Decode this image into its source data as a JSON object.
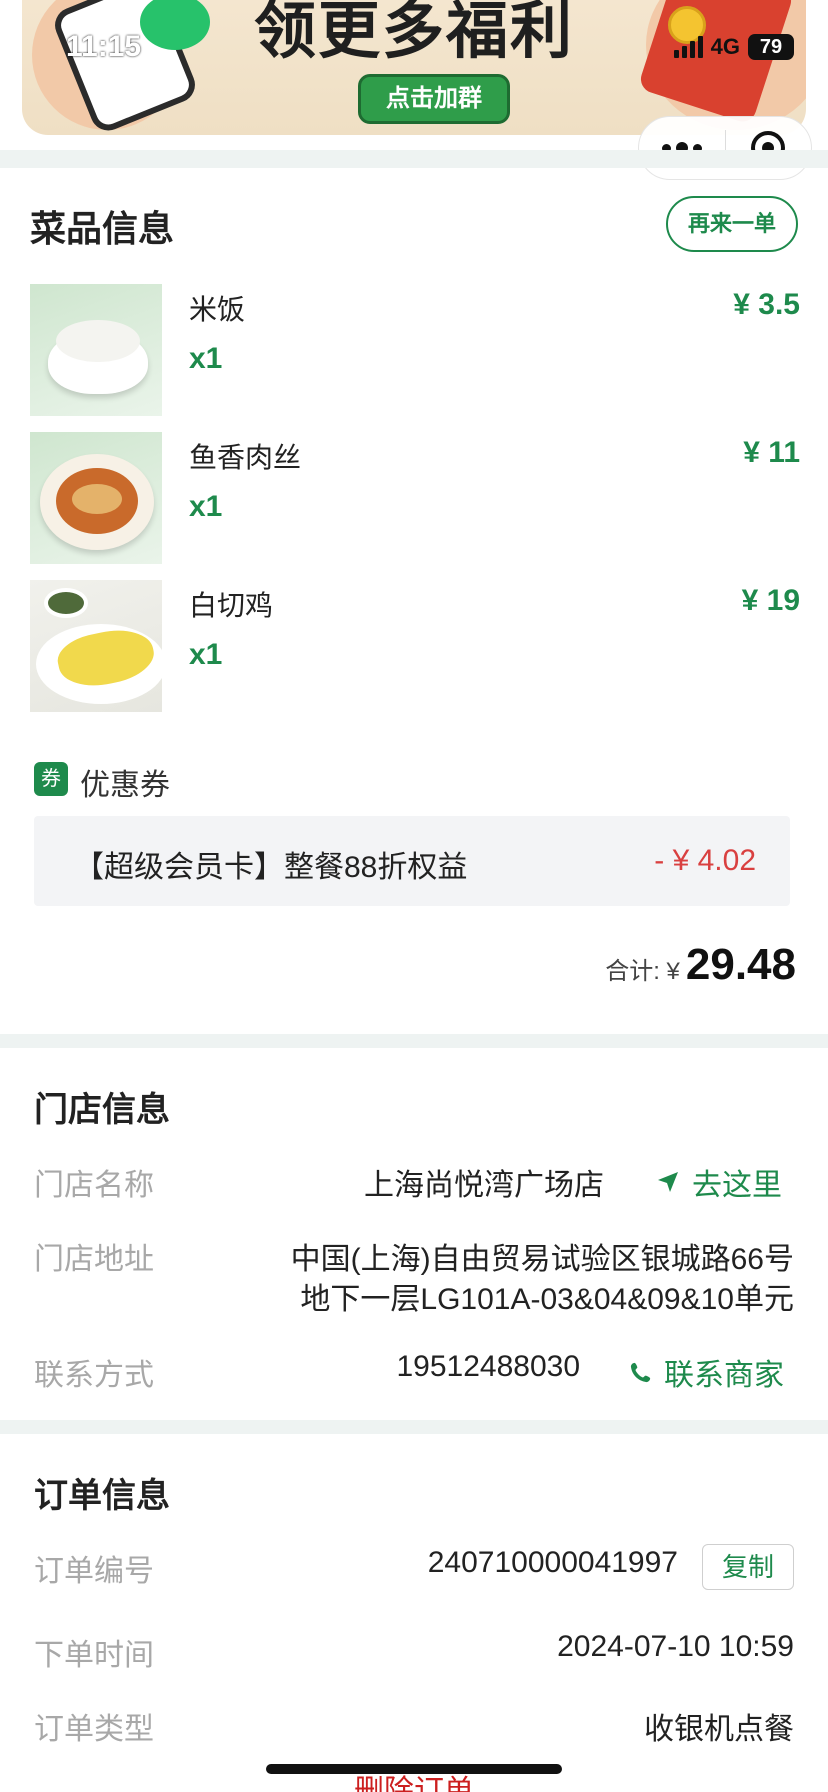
{
  "status_bar": {
    "time": "11:15",
    "network": "4G",
    "battery": "79"
  },
  "banner": {
    "headline": "领更多福利",
    "cta": "点击加群"
  },
  "dishes_section": {
    "title": "菜品信息",
    "reorder": "再来一单",
    "items": [
      {
        "name": "米饭",
        "qty": "x1",
        "price": "¥ 3.5"
      },
      {
        "name": "鱼香肉丝",
        "qty": "x1",
        "price": "¥ 11"
      },
      {
        "name": "白切鸡",
        "qty": "x1",
        "price": "¥ 19"
      }
    ],
    "coupon_tag": "券",
    "coupon_label": "优惠券",
    "coupon": {
      "desc": "【超级会员卡】整餐88折权益",
      "amount": "- ¥ 4.02"
    },
    "total_label": "合计: ¥",
    "total_value": "29.48"
  },
  "store_section": {
    "title": "门店信息",
    "name_label": "门店名称",
    "name_value": "上海尚悦湾广场店",
    "navigate": "去这里",
    "address_label": "门店地址",
    "address_line1": "中国(上海)自由贸易试验区银城路66号",
    "address_line2": "地下一层LG101A-03&04&09&10单元",
    "contact_label": "联系方式",
    "contact_value": "19512488030",
    "contact_action": "联系商家"
  },
  "order_section": {
    "title": "订单信息",
    "number_label": "订单编号",
    "number_value": "240710000041997",
    "copy": "复制",
    "time_label": "下单时间",
    "time_value": "2024-07-10 10:59",
    "type_label": "订单类型",
    "type_value": "收银机点餐",
    "delete": "删除订单"
  },
  "colors": {
    "accent": "#1e8a4c",
    "discount": "#d94040",
    "label_gray": "#a8a8a8",
    "section_bg": "#eef3f2"
  }
}
